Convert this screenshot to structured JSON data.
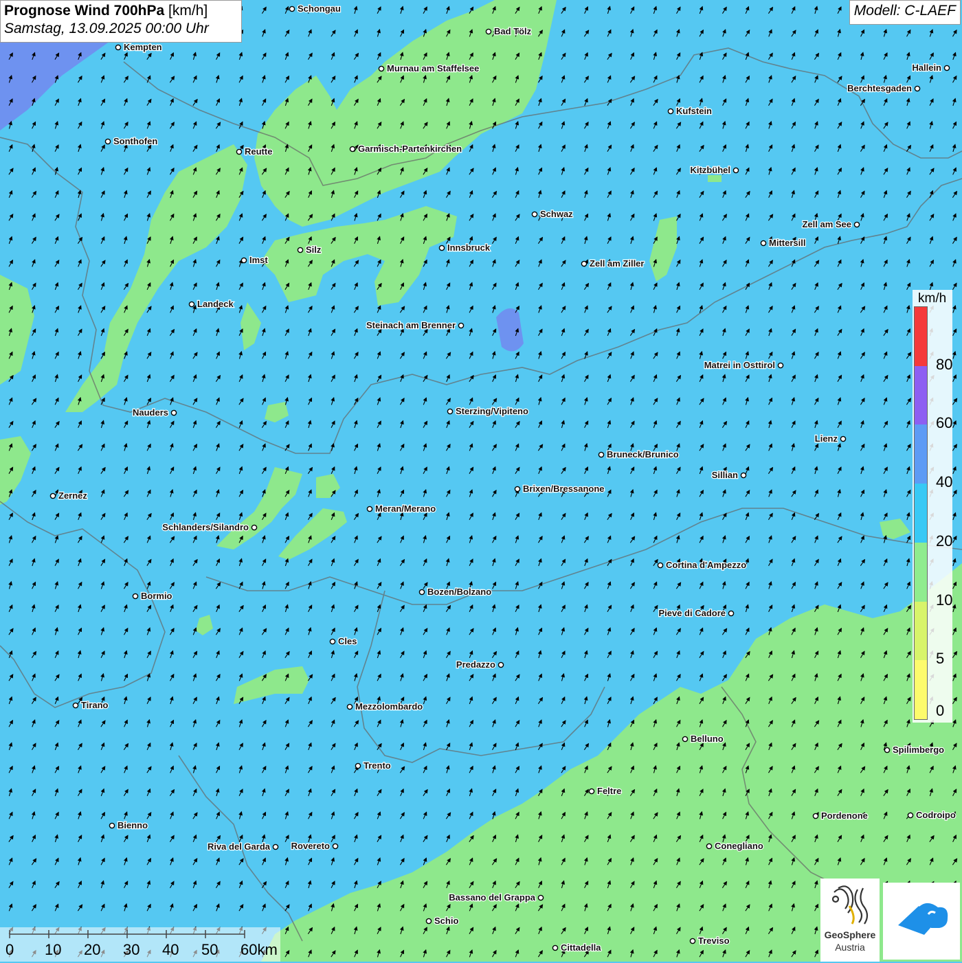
{
  "header": {
    "title": "Prognose Wind 700hPa",
    "unit": "[km/h]",
    "datetime": "Samstag, 13.09.2025 00:00 Uhr"
  },
  "model": "Modell: C-LAEF",
  "legend": {
    "unit": "km/h",
    "ticks": [
      "0",
      "5",
      "10",
      "20",
      "40",
      "60",
      "80"
    ],
    "colors": [
      "#fdfb6c",
      "#d8f46a",
      "#8fec8f",
      "#38c9f5",
      "#5d9bf5",
      "#8d5ff2",
      "#f53a3a"
    ]
  },
  "scalebar": {
    "labels": [
      "0",
      "10",
      "20",
      "30",
      "40",
      "50",
      "60km"
    ]
  },
  "logo": {
    "name": "GeoSphere",
    "sub": "Austria"
  },
  "background": {
    "water_blue": "#55c8f2",
    "calm_green": "#8ee88c",
    "strong_blue": "#6e92f0",
    "wind_direction": "north-east"
  },
  "cities": [
    "Schongau",
    "Bad Tölz",
    "Kempten",
    "Murnau am Staffelsee",
    "Hallein",
    "Berchtesgaden",
    "Kufstein",
    "Sonthofen",
    "Reutte",
    "Garmisch-Partenkirchen",
    "Kitzbühel",
    "Schwaz",
    "Zell am See",
    "Mittersill",
    "Innsbruck",
    "Silz",
    "Imst",
    "Zell am Ziller",
    "Landeck",
    "Steinach am Brenner",
    "Matrei in Osttirol",
    "Nauders",
    "Sterzing/Vipiteno",
    "Lienz",
    "Bruneck/Brunico",
    "Sillian",
    "Zernez",
    "Brixen/Bressanone",
    "Meran/Merano",
    "Schlanders/Silandro",
    "Cortina d'Ampezzo",
    "Bormio",
    "Bozen/Bolzano",
    "Pieve di Cadore",
    "Cles",
    "Predazzo",
    "Tirano",
    "Mezzolombardo",
    "Belluno",
    "Spilimbergo",
    "Trento",
    "Feltre",
    "Pordenone",
    "Codroipo",
    "Bienno",
    "Riva del Garda",
    "Rovereto",
    "Conegliano",
    "Bassano del Grappa",
    "Schio",
    "Treviso",
    "Cittadella"
  ]
}
